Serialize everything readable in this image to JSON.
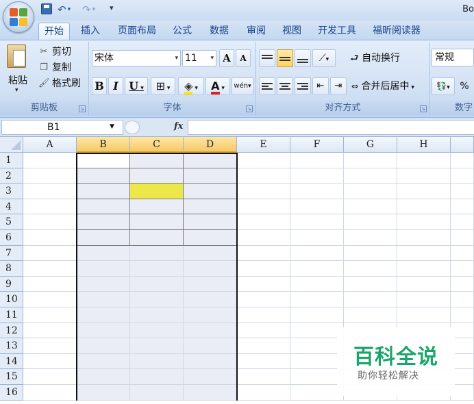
{
  "window": {
    "title_visible": "Bo"
  },
  "quick_access": {
    "save": "save-icon",
    "undo": "↶",
    "undo_arrow": "▾",
    "redo": "↷",
    "redo_arrow": "▾",
    "customize": "▾"
  },
  "tabs": [
    "开始",
    "插入",
    "页面布局",
    "公式",
    "数据",
    "审阅",
    "视图",
    "开发工具",
    "福昕阅读器"
  ],
  "clipboard": {
    "paste": "粘贴",
    "cut": "剪切",
    "copy": "复制",
    "format_painter": "格式刷",
    "label": "剪贴板"
  },
  "font": {
    "name": "宋体",
    "size": "11",
    "bold": "B",
    "italic": "I",
    "underline": "U",
    "grow": "A",
    "shrink": "A",
    "font_color_letter": "A",
    "phonetic": "wén",
    "label": "字体"
  },
  "alignment": {
    "wrap_text": "自动换行",
    "merge_center": "合并后居中",
    "label": "对齐方式"
  },
  "number": {
    "format": "常规",
    "percent": "%",
    "label": "数字"
  },
  "formula_bar": {
    "name_box": "B1",
    "fx": "fx",
    "formula": ""
  },
  "columns": [
    "A",
    "B",
    "C",
    "D",
    "E",
    "F",
    "G",
    "H"
  ],
  "rows": [
    "1",
    "2",
    "3",
    "4",
    "5",
    "6",
    "7",
    "8",
    "9",
    "10",
    "11",
    "12",
    "13",
    "14",
    "15",
    "16"
  ],
  "selection": {
    "columns": [
      "B",
      "C",
      "D"
    ],
    "active_cell": "B1",
    "highlight_cell": "C3",
    "highlight_color": "#ece84a"
  },
  "watermark": {
    "title": "百科全说",
    "subtitle": "助你轻松解决",
    "color": "#1aa56b"
  }
}
